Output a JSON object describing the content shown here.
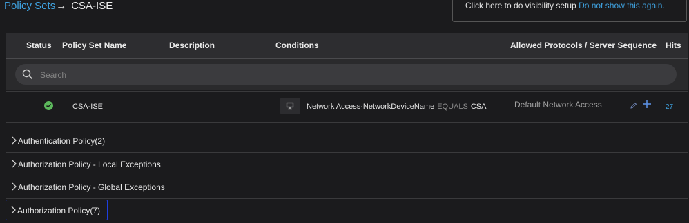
{
  "breadcrumb": {
    "parent": "Policy Sets",
    "arrow": "→",
    "current": "CSA-ISE"
  },
  "visibility_notice": {
    "text": "Click here to do visibility setup",
    "link": "Do not show this again."
  },
  "table_header": {
    "status": "Status",
    "policy_set_name": "Policy Set Name",
    "description": "Description",
    "conditions": "Conditions",
    "allowed_protocols": "Allowed Protocols / Server Sequence",
    "hits": "Hits"
  },
  "search": {
    "placeholder": "Search",
    "value": ""
  },
  "policy_row": {
    "status": "enabled",
    "status_color": "#5cb85c",
    "name": "CSA-ISE",
    "condition_attribute": "Network Access·NetworkDeviceName",
    "condition_operator": "EQUALS",
    "condition_value": "CSA",
    "allowed_protocol": "Default Network Access",
    "hits": "27"
  },
  "sections": [
    {
      "label": "Authentication Policy(2)"
    },
    {
      "label": "Authorization Policy - Local Exceptions"
    },
    {
      "label": "Authorization Policy - Global Exceptions"
    },
    {
      "label": "Authorization Policy(7)",
      "selected": true
    }
  ],
  "colors": {
    "accent": "#3fa2e0",
    "selection_border": "#1e3fe0",
    "background": "#1b1b1d",
    "header": "#2d2d30"
  }
}
